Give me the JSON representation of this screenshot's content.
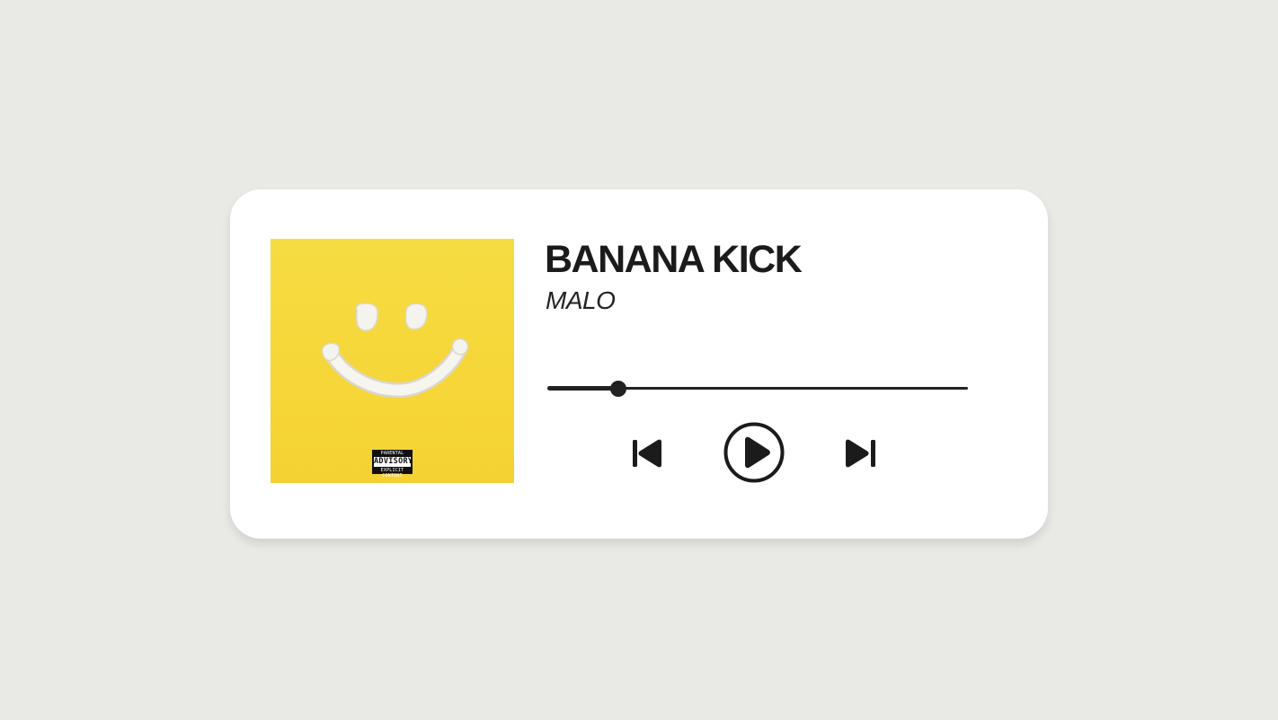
{
  "track": {
    "title": "BANANA KICK",
    "artist": "MALO"
  },
  "album_art": {
    "advisory_line1": "PARENTAL",
    "advisory_line2": "ADVISORY",
    "advisory_line3": "EXPLICIT CONTENT",
    "background_color": "#f5d83a"
  },
  "playback": {
    "progress": 0.168,
    "state": "paused"
  },
  "controls": {
    "previous_icon": "skip-previous-icon",
    "play_icon": "play-circle-icon",
    "next_icon": "skip-next-icon"
  },
  "colors": {
    "page_background": "#e9e9e5",
    "card_background": "#ffffff",
    "foreground": "#1b1b1b"
  }
}
